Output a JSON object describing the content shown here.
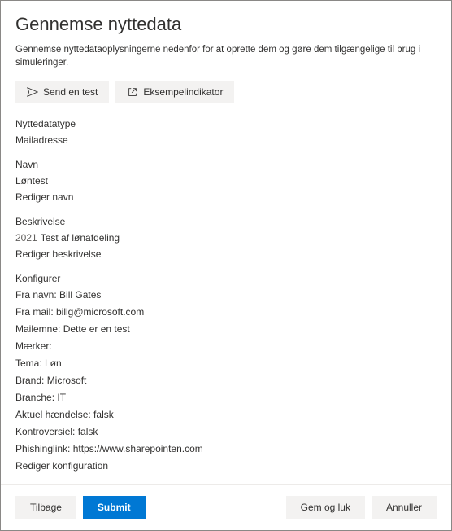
{
  "header": {
    "title": "Gennemse nyttedata",
    "subtitle": "Gennemse nyttedataoplysningerne nedenfor for at oprette dem og gøre dem tilgængelige til brug i simuleringer."
  },
  "actions": {
    "send_test": "Send en test",
    "example_indicator": "Eksempelindikator"
  },
  "payload_type": {
    "label": "Nyttedatatype",
    "value": "Mailadresse"
  },
  "name_section": {
    "label": "Navn",
    "value": "Løntest",
    "edit": "Rediger navn"
  },
  "description_section": {
    "label": "Beskrivelse",
    "year": "2021",
    "value": "Test af lønafdeling",
    "edit": "Rediger beskrivelse"
  },
  "configure": {
    "label": "Konfigurer",
    "from_name": "Fra navn: Bill Gates",
    "from_mail": "Fra mail: billg@microsoft.com",
    "mail_subject": "Mailemne: Dette er en test",
    "tags": "Mærker:",
    "theme": "Tema: Løn",
    "brand": "Brand: Microsoft",
    "branch": "Branche: IT",
    "current_event": "Aktuel hændelse: falsk",
    "controversial": "Kontroversiel: falsk",
    "phishing_link": "Phishinglink: https://www.sharepointen.com",
    "edit": "Rediger konfiguration"
  },
  "footer": {
    "back": "Tilbage",
    "submit": "Submit",
    "save_close": "Gem og luk",
    "cancel": "Annuller"
  }
}
